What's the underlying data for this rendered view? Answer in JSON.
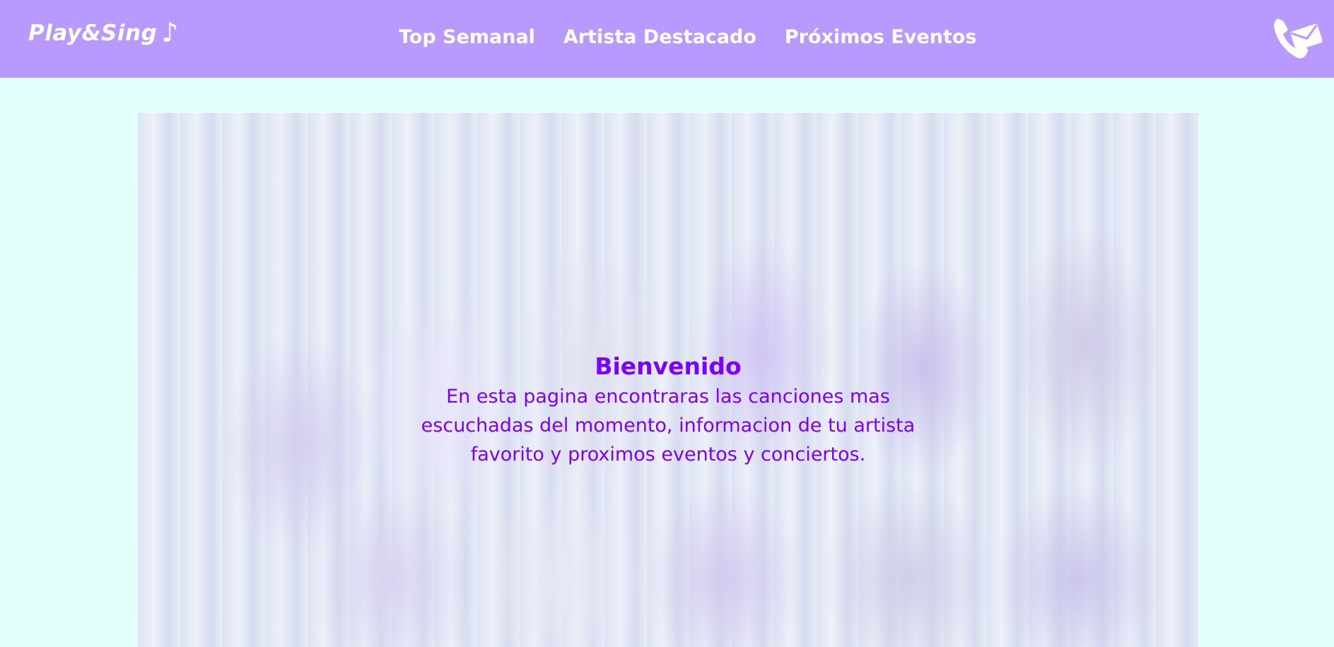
{
  "header": {
    "logo_text": "Play&Sing",
    "logo_symbol": "♪",
    "nav": [
      {
        "label": "Top Semanal"
      },
      {
        "label": "Artista Destacado"
      },
      {
        "label": "Próximos Eventos"
      }
    ],
    "contact_icon": "phone-mail-icon"
  },
  "hero": {
    "image": "group-photo",
    "title": "Bienvenido",
    "description": "En esta pagina encontraras las canciones mas escuchadas del momento, informacion de tu artista favorito y proximos eventos y conciertos."
  },
  "colors": {
    "header_bg": "#b89aff",
    "page_bg": "#e3fffa",
    "accent_text": "#7a00ff",
    "nav_text": "#ffffff"
  }
}
